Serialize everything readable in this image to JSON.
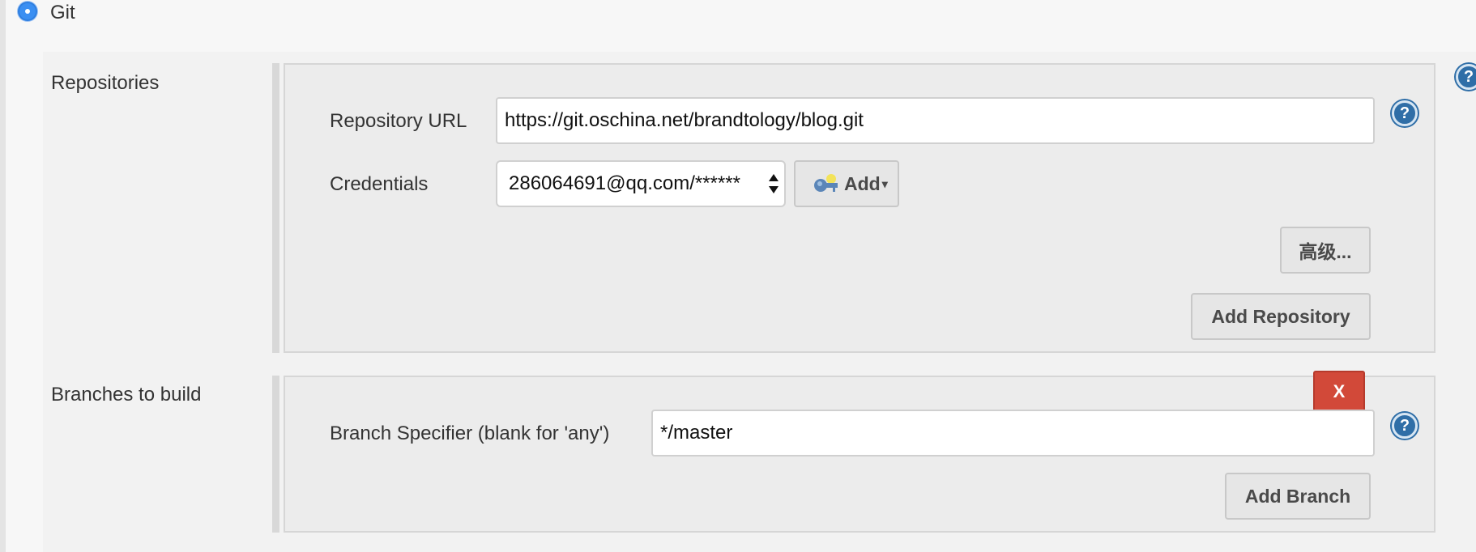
{
  "scm": {
    "option_label": "Git",
    "selected": true
  },
  "repositories": {
    "section_label": "Repositories",
    "url_label": "Repository URL",
    "url_value": "https://git.oschina.net/brandtology/blog.git",
    "credentials_label": "Credentials",
    "credentials_value": "286064691@qq.com/******",
    "add_credentials_label": "Add",
    "advanced_label": "高级...",
    "add_repository_label": "Add Repository"
  },
  "branches": {
    "section_label": "Branches to build",
    "specifier_label": "Branch Specifier (blank for 'any')",
    "specifier_value": "*/master",
    "delete_label": "X",
    "add_branch_label": "Add Branch"
  },
  "help_glyph": "?",
  "icons": [
    "radio-selected-icon",
    "key-icon",
    "select-arrows-icon",
    "help-icon"
  ],
  "colors": {
    "radio": "#3b8ff2",
    "delete": "#d24939",
    "help": "#2f6ea7"
  }
}
